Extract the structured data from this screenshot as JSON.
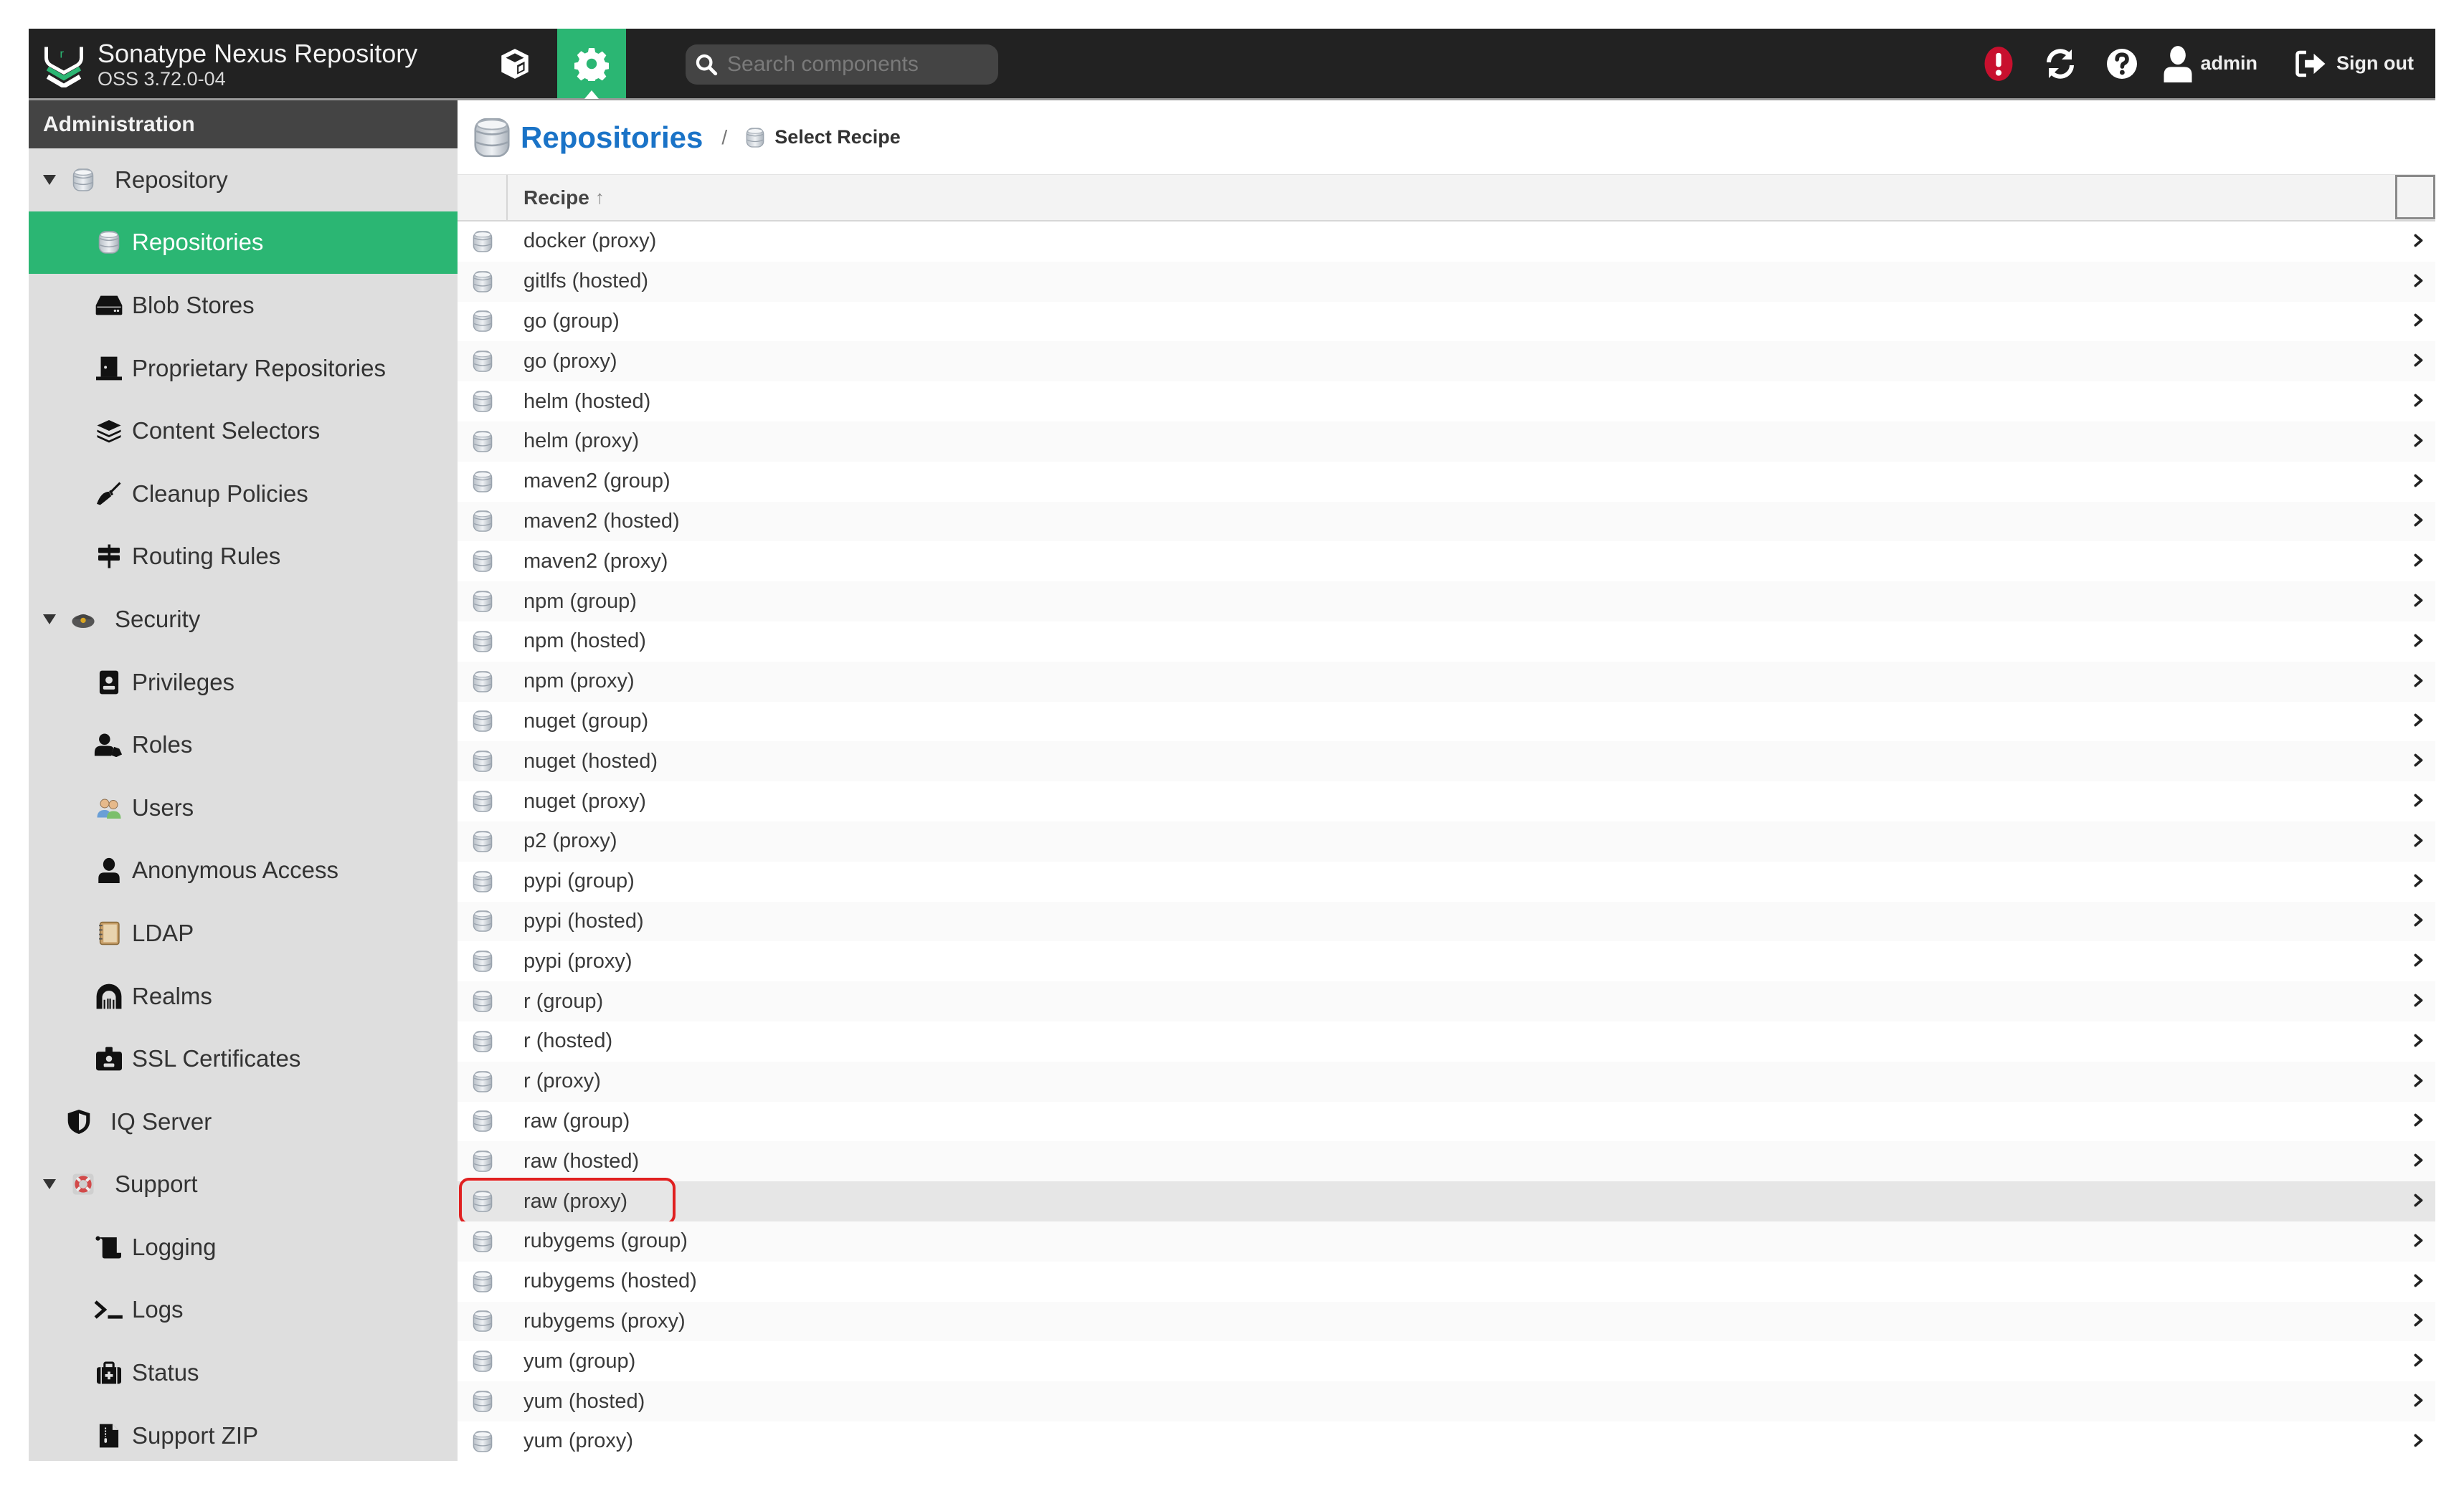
{
  "header": {
    "title": "Sonatype Nexus Repository",
    "version": "OSS 3.72.0-04",
    "search_placeholder": "Search components",
    "user": "admin",
    "signout": "Sign out",
    "accent_color": "#2bb673",
    "alert_color": "#c8102e",
    "icons": [
      "browse-cube-icon",
      "admin-gear-icon",
      "search-icon",
      "alert-icon",
      "refresh-icon",
      "help-icon",
      "user-icon",
      "sign-out-icon"
    ]
  },
  "sidebar": {
    "title": "Administration",
    "items": [
      {
        "label": "Repository",
        "level": 0,
        "expanded": true,
        "icon": "database-icon"
      },
      {
        "label": "Repositories",
        "level": 1,
        "selected": true,
        "icon": "database-icon"
      },
      {
        "label": "Blob Stores",
        "level": 1,
        "icon": "hard-drive-icon"
      },
      {
        "label": "Proprietary Repositories",
        "level": 1,
        "icon": "door-icon"
      },
      {
        "label": "Content Selectors",
        "level": 1,
        "icon": "layers-icon"
      },
      {
        "label": "Cleanup Policies",
        "level": 1,
        "icon": "broom-icon"
      },
      {
        "label": "Routing Rules",
        "level": 1,
        "icon": "signpost-icon"
      },
      {
        "label": "Security",
        "level": 0,
        "expanded": true,
        "icon": "security-officer-icon"
      },
      {
        "label": "Privileges",
        "level": 1,
        "icon": "id-badge-icon"
      },
      {
        "label": "Roles",
        "level": 1,
        "icon": "user-tag-icon"
      },
      {
        "label": "Users",
        "level": 1,
        "icon": "users-icon"
      },
      {
        "label": "Anonymous Access",
        "level": 1,
        "icon": "user-icon"
      },
      {
        "label": "LDAP",
        "level": 1,
        "icon": "address-book-icon"
      },
      {
        "label": "Realms",
        "level": 1,
        "icon": "archway-icon"
      },
      {
        "label": "SSL Certificates",
        "level": 1,
        "icon": "id-card-icon"
      },
      {
        "label": "IQ Server",
        "level": 0,
        "icon": "shield-icon"
      },
      {
        "label": "Support",
        "level": 0,
        "expanded": true,
        "icon": "lifebuoy-icon"
      },
      {
        "label": "Logging",
        "level": 1,
        "icon": "scroll-icon"
      },
      {
        "label": "Logs",
        "level": 1,
        "icon": "terminal-icon"
      },
      {
        "label": "Status",
        "level": 1,
        "icon": "medkit-icon"
      },
      {
        "label": "Support ZIP",
        "level": 1,
        "icon": "file-zip-icon"
      }
    ]
  },
  "main": {
    "breadcrumb": {
      "title": "Repositories",
      "separator": "/",
      "current": "Select Recipe"
    },
    "table": {
      "column": "Recipe",
      "sort": "ascending",
      "highlighted": "raw (proxy)",
      "rows": [
        "docker (proxy)",
        "gitlfs (hosted)",
        "go (group)",
        "go (proxy)",
        "helm (hosted)",
        "helm (proxy)",
        "maven2 (group)",
        "maven2 (hosted)",
        "maven2 (proxy)",
        "npm (group)",
        "npm (hosted)",
        "npm (proxy)",
        "nuget (group)",
        "nuget (hosted)",
        "nuget (proxy)",
        "p2 (proxy)",
        "pypi (group)",
        "pypi (hosted)",
        "pypi (proxy)",
        "r (group)",
        "r (hosted)",
        "r (proxy)",
        "raw (group)",
        "raw (hosted)",
        "raw (proxy)",
        "rubygems (group)",
        "rubygems (hosted)",
        "rubygems (proxy)",
        "yum (group)",
        "yum (hosted)",
        "yum (proxy)"
      ]
    }
  }
}
